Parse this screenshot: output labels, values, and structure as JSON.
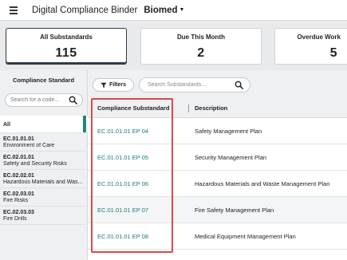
{
  "header": {
    "app_title": "Digital Compliance Binder",
    "department": "Biomed",
    "icons": {
      "menu": "hamburger-icon",
      "dropdown": "caret-down-icon"
    }
  },
  "cards": [
    {
      "label": "All Substandards",
      "value": "115"
    },
    {
      "label": "Due This Month",
      "value": "2"
    },
    {
      "label": "Overdue Work",
      "value": "5"
    }
  ],
  "sidebar": {
    "title": "Compliance Standard",
    "search_placeholder": "Search for a code...",
    "all_label": "All",
    "items": [
      {
        "code": "EC.01.01.01",
        "desc": "Environment of Care"
      },
      {
        "code": "EC.02.01.01",
        "desc": "Safety and Security Risks"
      },
      {
        "code": "EC.02.02.01",
        "desc": "Hazardous Materials and Was..."
      },
      {
        "code": "EC.02.03.01",
        "desc": "Fire Risks"
      },
      {
        "code": "EC.02.03.03",
        "desc": "Fire Drills"
      }
    ]
  },
  "toolbar": {
    "filters_label": "Filters",
    "search_placeholder": "Search Substandards..."
  },
  "table": {
    "columns": [
      "Compliance Substandard",
      "Description"
    ],
    "rows": [
      {
        "substandard": "EC.01.01.01 EP 04",
        "description": "Safety Management Plan"
      },
      {
        "substandard": "EC.01.01.01 EP 05",
        "description": "Security Management Plan"
      },
      {
        "substandard": "EC.01.01.01 EP 06",
        "description": "Hazardous Materials and Waste Management Plan"
      },
      {
        "substandard": "EC.01.01.01 EP 07",
        "description": "Fire Safety Management Plan"
      },
      {
        "substandard": "EC.01.01.01 EP 08",
        "description": "Medical Equipment Management Plan"
      }
    ]
  },
  "colors": {
    "accent": "#1f8a6f",
    "link": "#1a7c74",
    "highlight": "#d94a4a",
    "active_card_border": "#2e3a4a"
  }
}
